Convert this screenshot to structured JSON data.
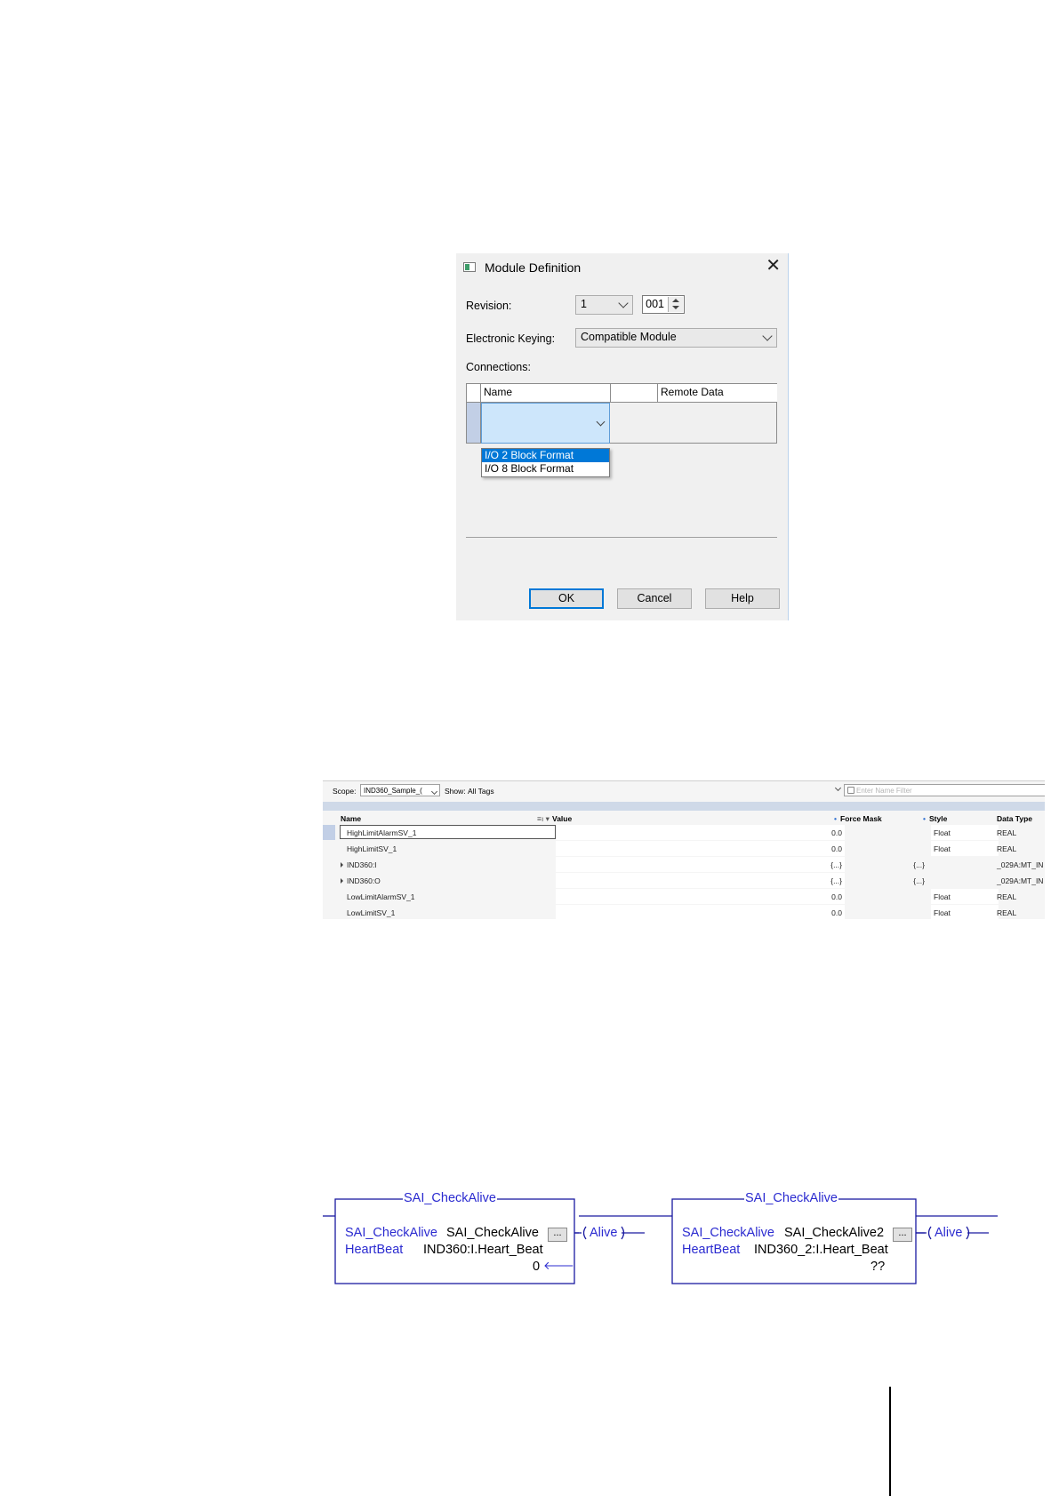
{
  "module_definition": {
    "title": "Module Definition",
    "close_glyph": "✕",
    "revision_label": "Revision:",
    "revision_major": "1",
    "revision_minor": "001",
    "keying_label": "Electronic Keying:",
    "keying_value": "Compatible Module",
    "connections_label": "Connections:",
    "columns": [
      "Name",
      "",
      "Remote Data"
    ],
    "dropdown_options": [
      "I/O 2 Block Format",
      "I/O 8 Block Format"
    ],
    "selected_option": "I/O 2 Block Format",
    "buttons": {
      "ok": "OK",
      "cancel": "Cancel",
      "help": "Help"
    }
  },
  "tag_editor": {
    "scope_label": "Scope:",
    "scope_value": "IND360_Sample_(",
    "show_label": "Show:",
    "show_value": "All Tags",
    "filter_placeholder": "Enter Name Filter",
    "columns": {
      "name": "Name",
      "value": "Value",
      "force_mask": "Force Mask",
      "style": "Style",
      "data_type": "Data Type"
    },
    "rows": [
      {
        "name": "HighLimitAlarmSV_1",
        "value": "0.0",
        "force_mask": "",
        "style": "Float",
        "data_type": "REAL",
        "expandable": false,
        "selected": true
      },
      {
        "name": "HighLimitSV_1",
        "value": "0.0",
        "force_mask": "",
        "style": "Float",
        "data_type": "REAL",
        "expandable": false,
        "selected": false
      },
      {
        "name": "IND360:I",
        "value": "{...}",
        "force_mask": "{...}",
        "style": "",
        "data_type": "_029A:MT_IN",
        "expandable": true,
        "selected": false
      },
      {
        "name": "IND360:O",
        "value": "{...}",
        "force_mask": "{...}",
        "style": "",
        "data_type": "_029A:MT_IN",
        "expandable": true,
        "selected": false
      },
      {
        "name": "LowLimitAlarmSV_1",
        "value": "0.0",
        "force_mask": "",
        "style": "Float",
        "data_type": "REAL",
        "expandable": false,
        "selected": false
      },
      {
        "name": "LowLimitSV_1",
        "value": "0.0",
        "force_mask": "",
        "style": "Float",
        "data_type": "REAL",
        "expandable": false,
        "selected": false
      }
    ]
  },
  "ladder": {
    "blocks": [
      {
        "title": "SAI_CheckAlive",
        "param1_label": "SAI_CheckAlive",
        "param1_value": "SAI_CheckAlive",
        "param2_label": "HeartBeat",
        "param2_value": "IND360:I.Heart_Beat",
        "live_value": "0",
        "live_marker": "🡐",
        "output_coil": "Alive",
        "button": "..."
      },
      {
        "title": "SAI_CheckAlive",
        "param1_label": "SAI_CheckAlive",
        "param1_value": "SAI_CheckAlive2",
        "param2_label": "HeartBeat",
        "param2_value": "IND360_2:I.Heart_Beat",
        "live_value": "??",
        "live_marker": "",
        "output_coil": "Alive",
        "button": "..."
      }
    ]
  }
}
